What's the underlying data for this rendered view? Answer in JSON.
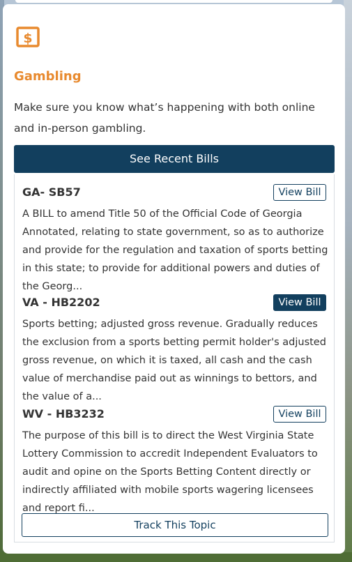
{
  "topic": {
    "icon": "dollar-icon",
    "title": "Gambling",
    "description": "Make sure you know what’s happening with both online and in-person gambling.",
    "accent_color": "#e88a2f",
    "primary_color": "#123f5e"
  },
  "see_bills_label": "See Recent Bills",
  "bills": [
    {
      "id": "GA- SB57",
      "button_label": "View Bill",
      "summary": "A BILL to amend Title 50 of the Official Code of Georgia Annotated, relating to state government, so as to authorize and provide for the regulation and taxation of sports betting in this state; to provide for additional powers and duties of the Georg..."
    },
    {
      "id": "VA - HB2202",
      "button_label": "View Bill",
      "summary": "Sports betting; adjusted gross revenue. Gradually reduces the exclusion from a sports betting permit holder's adjusted gross revenue, on which it is taxed, all cash and the cash value of merchandise paid out as winnings to bettors, and the value of a..."
    },
    {
      "id": "WV - HB3232",
      "button_label": "View Bill",
      "summary": "The purpose of this bill is to direct the West Virginia State Lottery Commission to accredit Independent Evaluators to audit and opine on the Sports Betting Content directly or indirectly affiliated with mobile sports wagering licensees and report fi..."
    }
  ],
  "track_label": "Track This Topic"
}
